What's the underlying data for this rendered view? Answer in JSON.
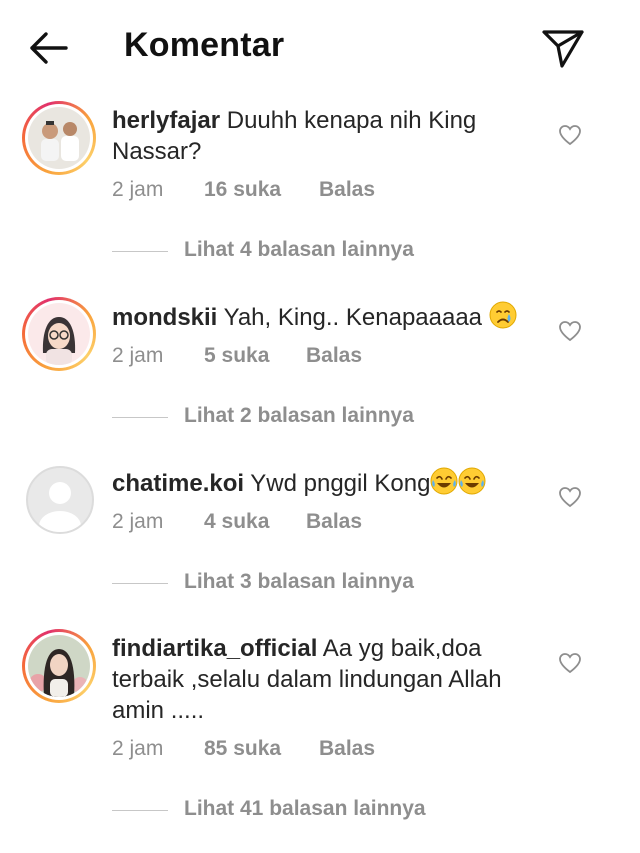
{
  "header": {
    "title": "Komentar"
  },
  "comments": [
    {
      "username": "herlyfajar",
      "text": "Duuhh kenapa nih King Nassar?",
      "time": "2 jam",
      "likes": "16 suka",
      "reply_label": "Balas",
      "view_replies": "Lihat 4 balasan lainnya"
    },
    {
      "username": "mondskii",
      "text": "Yah, King.. Kenapaaaaa",
      "time": "2 jam",
      "likes": "5 suka",
      "reply_label": "Balas",
      "view_replies": "Lihat 2 balasan lainnya"
    },
    {
      "username": "chatime.koi",
      "text": "Ywd pnggil Kong",
      "time": "2 jam",
      "likes": "4 suka",
      "reply_label": "Balas",
      "view_replies": "Lihat 3 balasan lainnya"
    },
    {
      "username": "findiartika_official",
      "text": "Aa yg baik,doa terbaik ,selalu dalam lindungan Allah amin .....",
      "time": "2 jam",
      "likes": "85 suka",
      "reply_label": "Balas",
      "view_replies": "Lihat 41 balasan lainnya"
    }
  ],
  "icons": {
    "back": "arrow-left-icon",
    "share": "paper-plane-icon",
    "like": "heart-outline-icon",
    "crying": "crying-face-emoji",
    "laughing": "tears-of-joy-emoji"
  },
  "colors": {
    "text": "#262626",
    "secondary": "#8e8e8e",
    "story_ring_start": "#f9a23c",
    "story_ring_end": "#e1306c"
  }
}
